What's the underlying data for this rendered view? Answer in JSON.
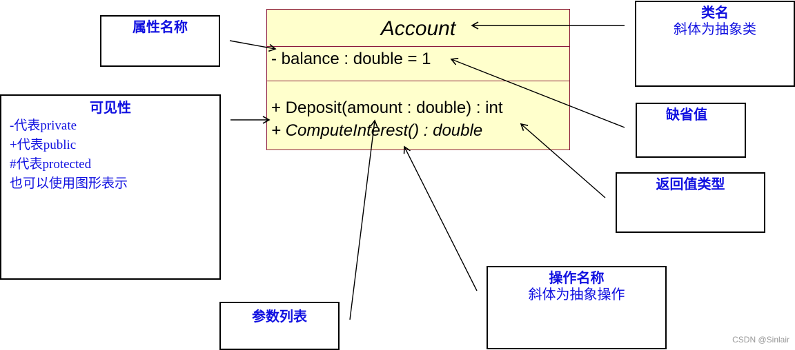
{
  "uml_class": {
    "name": "Account",
    "attributes": [
      "- balance : double = 1"
    ],
    "operations": [
      {
        "text": "+ Deposit(amount : double) : int",
        "abstract": false
      },
      {
        "text": "+ ComputeInterest() : double",
        "abstract": true
      }
    ]
  },
  "annotations": {
    "attribute_name": {
      "title": "属性名称"
    },
    "visibility": {
      "title": "可见性",
      "lines": [
        "-代表private",
        "+代表public",
        "#代表protected",
        "也可以使用图形表示"
      ]
    },
    "class_name": {
      "title": "类名",
      "subtitle": "斜体为抽象类"
    },
    "default_value": {
      "title": "缺省值"
    },
    "return_type": {
      "title": "返回值类型"
    },
    "operation_name": {
      "title": "操作名称",
      "subtitle": "斜体为抽象操作"
    },
    "parameter_list": {
      "title": "参数列表"
    }
  },
  "colors": {
    "label_text": "#1010e0",
    "class_fill": "#ffffcc",
    "class_border": "#8b1a3a"
  },
  "watermark": "CSDN @Sinlair"
}
